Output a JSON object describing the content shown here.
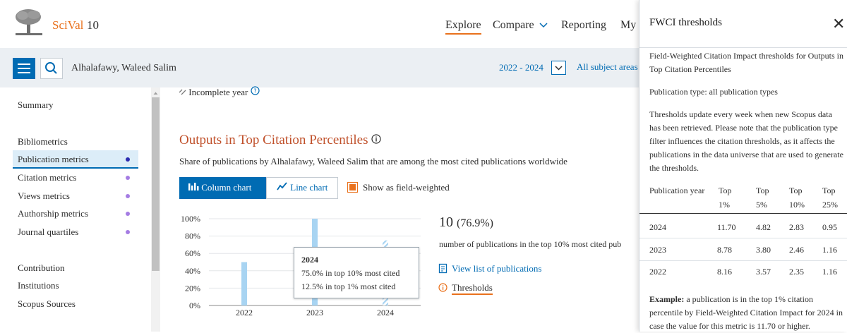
{
  "app": {
    "brand": "SciVal",
    "version": "10"
  },
  "nav": {
    "explore": "Explore",
    "compare": "Compare",
    "reporting": "Reporting",
    "my": "My"
  },
  "entity": {
    "name": "Alhalafawy, Waleed Salim",
    "year_range": "2022 - 2024",
    "subject": "All subject areas"
  },
  "sidebar": {
    "summary": "Summary",
    "bibliometrics_heading": "Bibliometrics",
    "items": [
      "Publication metrics",
      "Citation metrics",
      "Views metrics",
      "Authorship metrics",
      "Journal quartiles"
    ],
    "contribution_heading": "Contribution",
    "contribution_items": [
      "Institutions",
      "Scopus Sources"
    ]
  },
  "main": {
    "incomplete_year": "Incomplete year",
    "section_title": "Outputs in Top Citation Percentiles",
    "section_sub": "Share of publications by Alhalafawy, Waleed Salim that are among the most cited publications worldwide",
    "btn_column": "Column chart",
    "btn_line": "Line chart",
    "checkbox_label": "Show as field-weighted",
    "stat_value": "10",
    "stat_pct": "(76.9%)",
    "stat_desc": "number of publications in the top 10% most cited pub",
    "link_view": "View list of publications",
    "link_thresholds": "Thresholds"
  },
  "tooltip": {
    "year": "2024",
    "line1": "75.0% in top 10% most cited",
    "line2": "12.5% in top 1% most cited"
  },
  "chart_data": {
    "type": "bar",
    "categories": [
      "2022",
      "2023",
      "2024"
    ],
    "series": [
      {
        "values": [
          50,
          100,
          75
        ]
      }
    ],
    "incomplete_year": "2024",
    "y_ticks": [
      "0%",
      "20%",
      "40%",
      "60%",
      "80%",
      "100%"
    ],
    "ylim": [
      0,
      100
    ],
    "grid": true,
    "colors": {
      "bar": "#a8d4f2"
    }
  },
  "panel": {
    "title": "FWCI thresholds",
    "intro": "Field-Weighted Citation Impact thresholds for Outputs in Top Citation Percentiles",
    "pub_type": "Publication type: all publication types",
    "update_note": "Thresholds update every week when new Scopus data has been retrieved. Please note that the publication type filter influences the citation thresholds, as it affects the publications in the data universe that are used to generate the thresholds.",
    "table": {
      "headers": [
        "Publication year",
        "Top 1%",
        "Top 5%",
        "Top 10%",
        "Top 25%"
      ],
      "rows": [
        [
          "2024",
          "11.70",
          "4.82",
          "2.83",
          "0.95"
        ],
        [
          "2023",
          "8.78",
          "3.80",
          "2.46",
          "1.16"
        ],
        [
          "2022",
          "8.16",
          "3.57",
          "2.35",
          "1.16"
        ]
      ]
    },
    "example_label": "Example:",
    "example_text": "a publication is in the top 1% citation percentile by Field-Weighted Citation Impact for 2024 in case the value for this metric is 11.70 or higher."
  },
  "colors": {
    "accent_orange": "#e9711c",
    "primary_blue": "#006bb3",
    "title_red": "#c0502a"
  }
}
